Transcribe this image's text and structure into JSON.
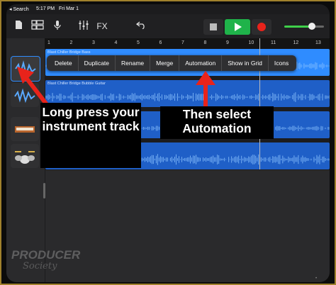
{
  "status_bar": {
    "back_label": "◂ Search",
    "time": "5:17 PM",
    "date": "Fri Mar 1"
  },
  "toolbar": {
    "icons": [
      "document-icon",
      "track-view-icon",
      "microphone-icon",
      "mixer-icon"
    ],
    "fx_label": "FX"
  },
  "ruler": {
    "ticks": [
      "1",
      "2",
      "3",
      "4",
      "5",
      "6",
      "7",
      "8",
      "9",
      "10",
      "11",
      "12",
      "13"
    ]
  },
  "tracks": [
    {
      "name": "Blast Chiller Bridge Bass",
      "color": "#2f8cff",
      "selected": true,
      "icon": "bass-wave-icon"
    },
    {
      "name": "Blast Chiller Bridge Bubble Guitar",
      "color": "#1f5fc7",
      "selected": false,
      "icon": "guitar-wave-icon"
    },
    {
      "name": "",
      "color": "#1f5fc7",
      "selected": false,
      "icon": "keyboard-icon"
    },
    {
      "name": "",
      "color": "#1f5fc7",
      "selected": false,
      "icon": "drum-kit-icon"
    }
  ],
  "context_menu": [
    "Delete",
    "Duplicate",
    "Rename",
    "Merge",
    "Automation",
    "Show in Grid",
    "Icons"
  ],
  "captions": {
    "left": "Long press your instrument track",
    "right": "Then select Automation"
  },
  "logo": {
    "line1": "PRODUCER",
    "line2": "Society"
  },
  "colors": {
    "accent_arrow": "#e8231b",
    "play": "#1fb34a",
    "record": "#e8231b",
    "region": "#2f8cff"
  }
}
